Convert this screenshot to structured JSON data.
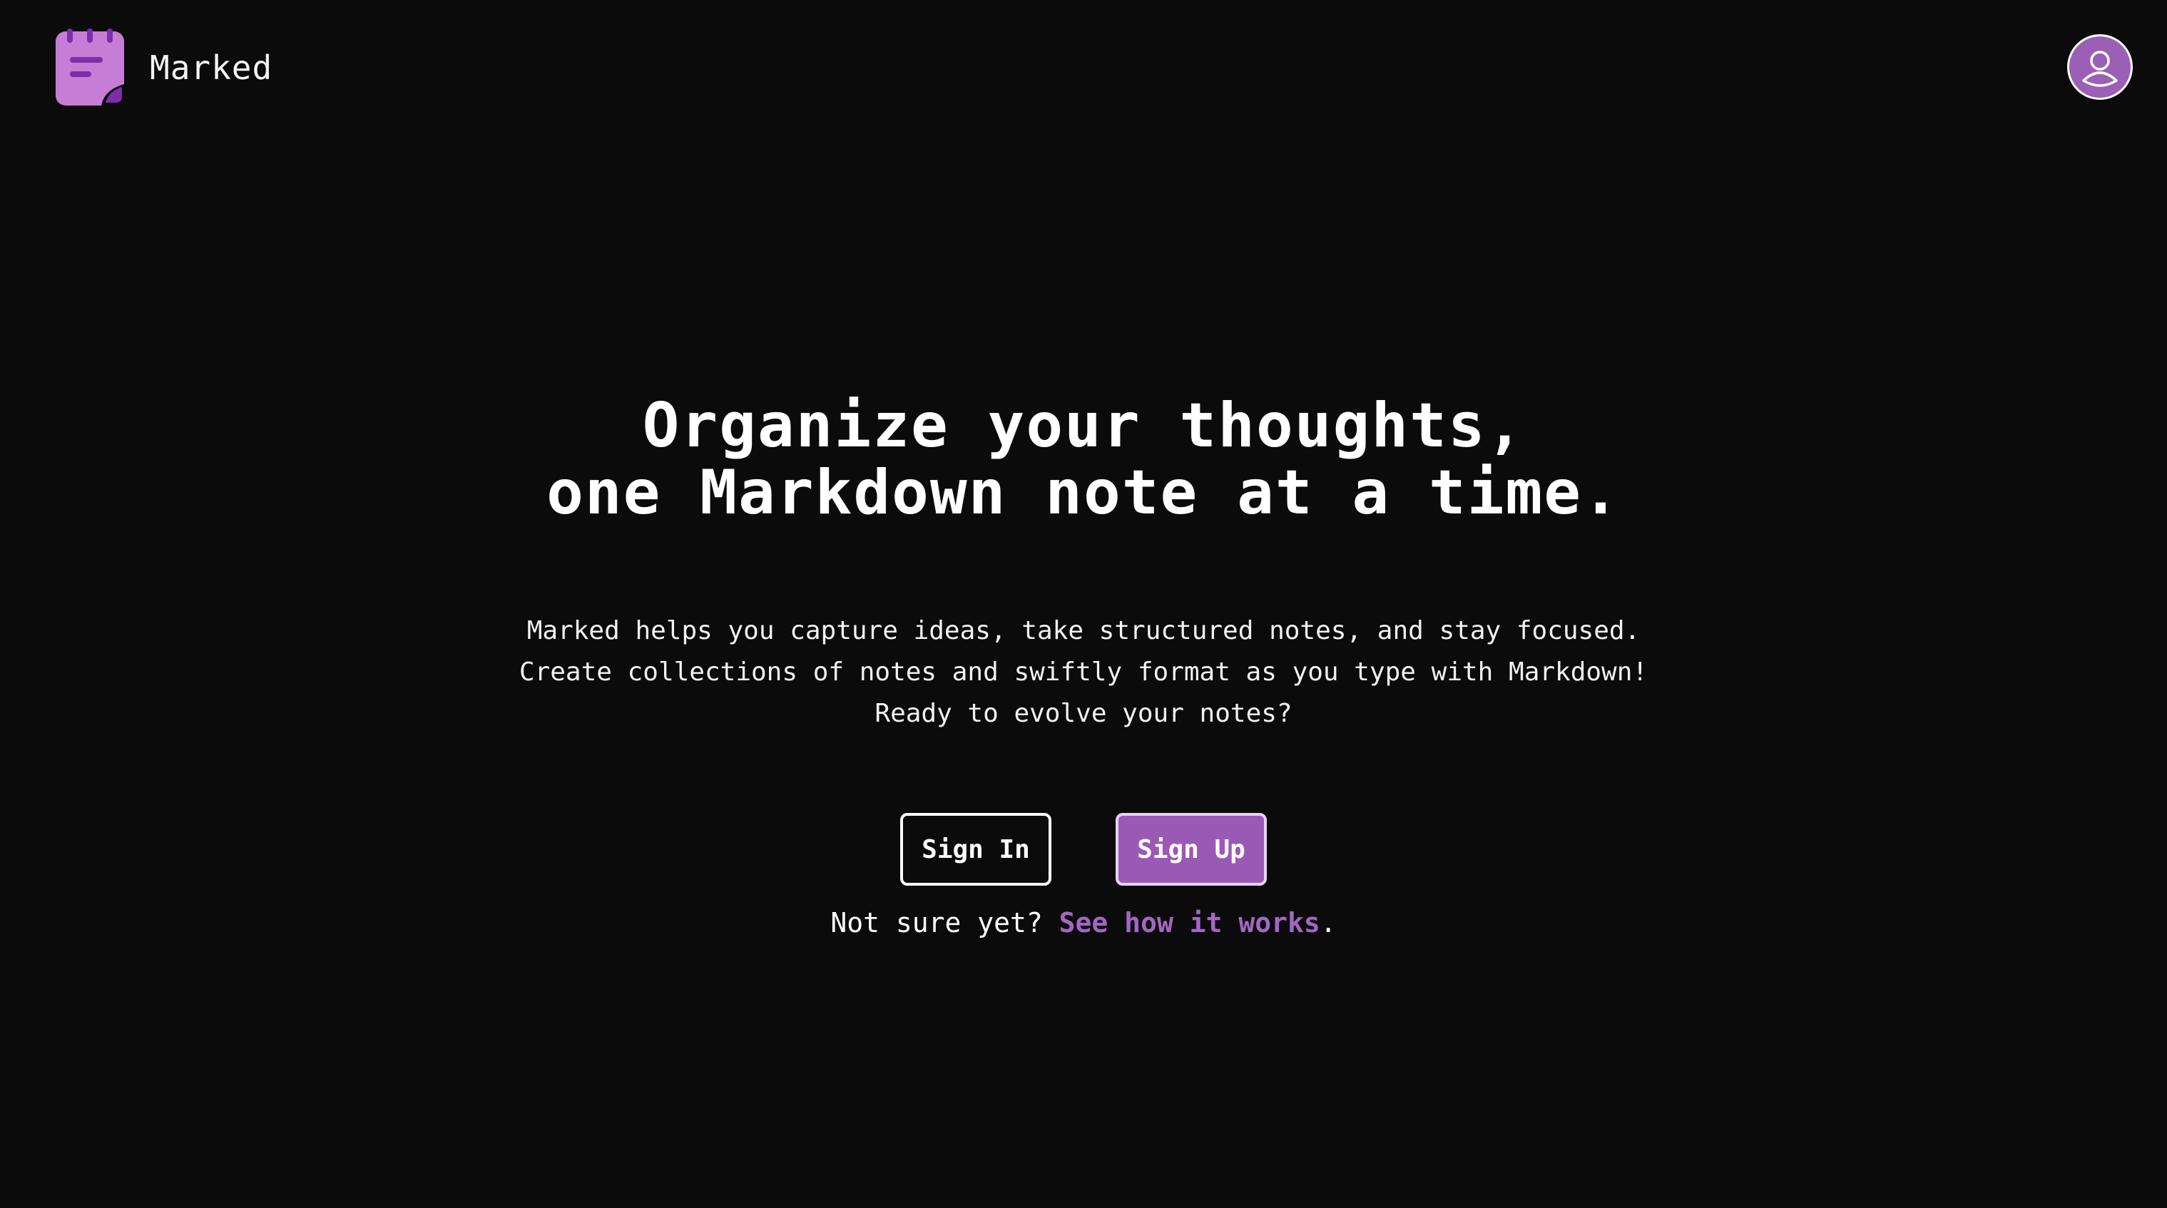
{
  "header": {
    "brand_name": "Marked",
    "logo_icon": "notepad-icon",
    "avatar_icon": "user-icon"
  },
  "hero": {
    "headline_line1": "Organize your thoughts,",
    "headline_line2": "one Markdown note at a time.",
    "sub_line1": "Marked helps you capture ideas, take structured notes, and stay focused.",
    "sub_line2": "Create collections of notes and swiftly format as you type with Markdown!",
    "sub_line3": "Ready to evolve your notes?"
  },
  "actions": {
    "sign_in_label": "Sign In",
    "sign_up_label": "Sign Up"
  },
  "help": {
    "prefix": "Not sure yet? ",
    "link_label": "See how it works",
    "suffix": "."
  },
  "colors": {
    "background": "#0b0b0b",
    "accent": "#9b59b6",
    "link": "#a466c4",
    "text": "#ffffff"
  }
}
